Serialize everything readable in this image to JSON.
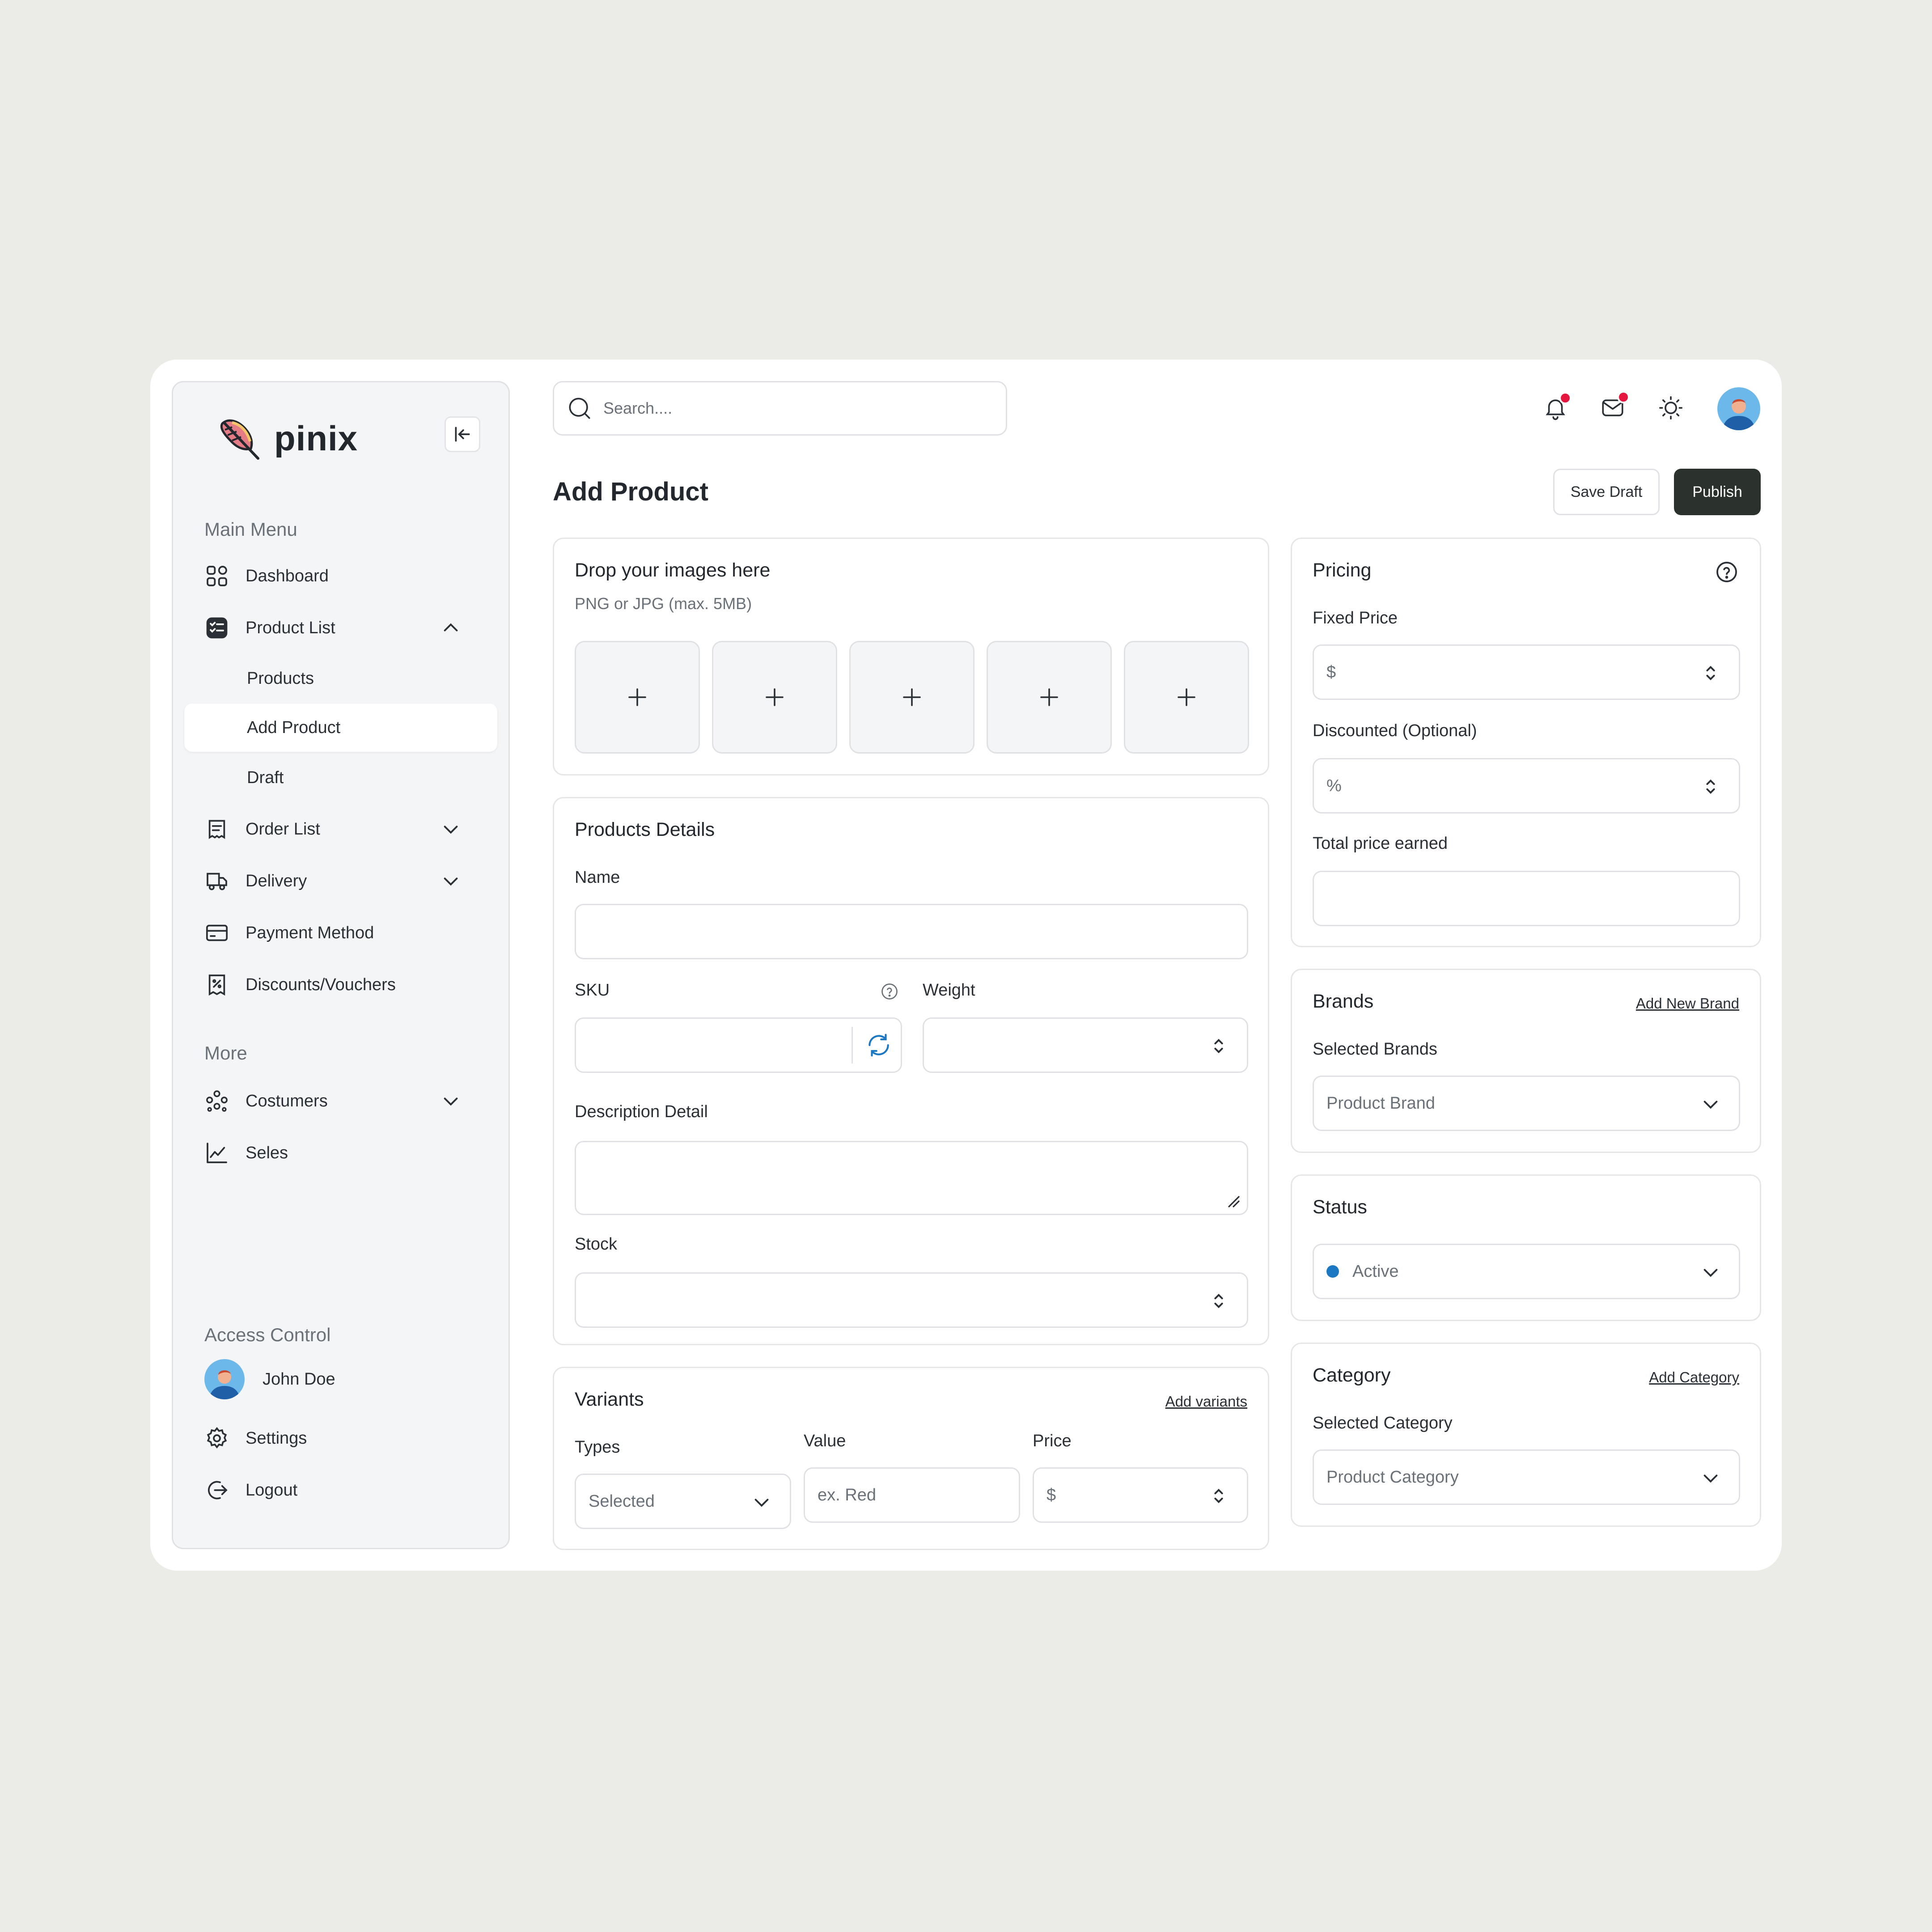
{
  "sidebar": {
    "brand_name": "pinix",
    "main_menu_label": "Main Menu",
    "items": [
      {
        "label": "Dashboard",
        "icon": "grid-icon"
      },
      {
        "label": "Product List",
        "icon": "list-check-icon"
      },
      {
        "label": "Order List",
        "icon": "receipt-icon"
      },
      {
        "label": "Delivery",
        "icon": "truck-icon"
      },
      {
        "label": "Payment Method",
        "icon": "credit-card-icon"
      },
      {
        "label": "Discounts/Vouchers",
        "icon": "voucher-icon"
      }
    ],
    "product_sub_items": [
      "Products",
      "Add Product",
      "Draft"
    ],
    "more_label": "More",
    "more_items": [
      {
        "label": "Costumers",
        "icon": "users-icon"
      },
      {
        "label": "Seles",
        "icon": "chart-icon"
      }
    ],
    "access_label": "Access Control",
    "user_name": "John Doe",
    "settings_label": "Settings",
    "logout_label": "Logout"
  },
  "header": {
    "search_placeholder": "Search....",
    "page_title": "Add Product",
    "save_draft_label": "Save Draft",
    "publish_label": "Publish"
  },
  "images": {
    "title": "Drop your images here",
    "hint": "PNG or JPG (max. 5MB)",
    "slots": [
      "+",
      "+",
      "+",
      "+",
      "+"
    ]
  },
  "details": {
    "title": "Products Details",
    "name_label": "Name",
    "sku_label": "SKU",
    "weight_label": "Weight",
    "description_label": "Description Detail",
    "stock_label": "Stock"
  },
  "variants": {
    "title": "Variants",
    "add_link": "Add variants",
    "types_label": "Types",
    "types_value": "Selected",
    "value_label": "Value",
    "value_placeholder": "ex. Red",
    "price_label": "Price",
    "price_placeholder": "$"
  },
  "pricing": {
    "title": "Pricing",
    "fixed_label": "Fixed Price",
    "fixed_placeholder": "$",
    "discount_label": "Discounted (Optional)",
    "discount_placeholder": "%",
    "total_label": "Total price earned"
  },
  "brands": {
    "title": "Brands",
    "add_link": "Add New Brand",
    "selected_label": "Selected Brands",
    "value": "Product Brand"
  },
  "status": {
    "title": "Status",
    "value": "Active",
    "dot_color": "#1c78c2"
  },
  "category": {
    "title": "Category",
    "add_link": "Add Category",
    "selected_label": "Selected Category",
    "value": "Product Category"
  },
  "colors": {
    "accent_dark": "#2b322d",
    "notification": "#e5173f",
    "background": "#ebebe7"
  }
}
